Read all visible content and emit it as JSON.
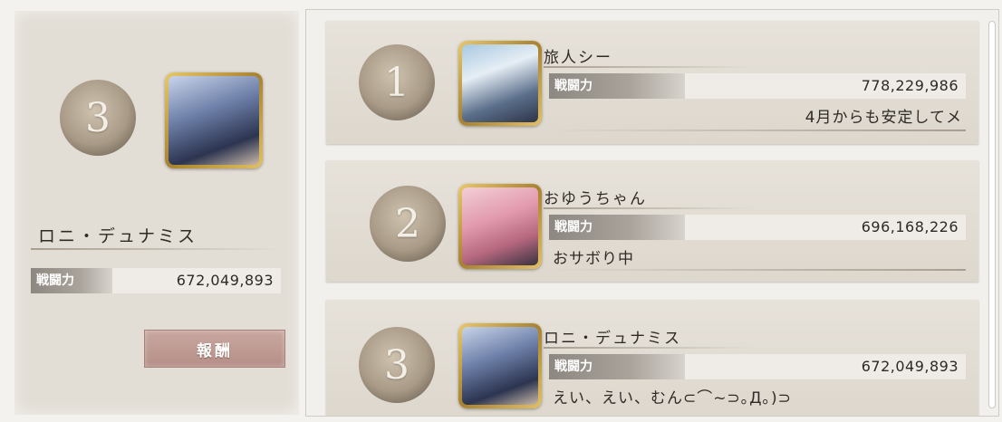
{
  "player": {
    "rank": "3",
    "name": "ロニ・デュナミス",
    "power_label": "戦闘力",
    "power_value": "672,049,893",
    "reward_button_label": "報酬"
  },
  "ranking": [
    {
      "rank": "1",
      "name": "旅人シー",
      "power_label": "戦闘力",
      "power_value": "778,229,986",
      "comment": "4月からも安定してメ"
    },
    {
      "rank": "2",
      "name": "おゆうちゃん",
      "power_label": "戦闘力",
      "power_value": "696,168,226",
      "comment": "おサボり中"
    },
    {
      "rank": "3",
      "name": "ロニ・デュナミス",
      "power_label": "戦闘力",
      "power_value": "672,049,893",
      "comment": "えい、えい、むん⊂⌒~⊃｡Д｡)⊃"
    }
  ],
  "colors": {
    "reward_button": "#b8948d",
    "frame_gold": "#c9a24a",
    "panel_bg": "#e2ddd5"
  }
}
